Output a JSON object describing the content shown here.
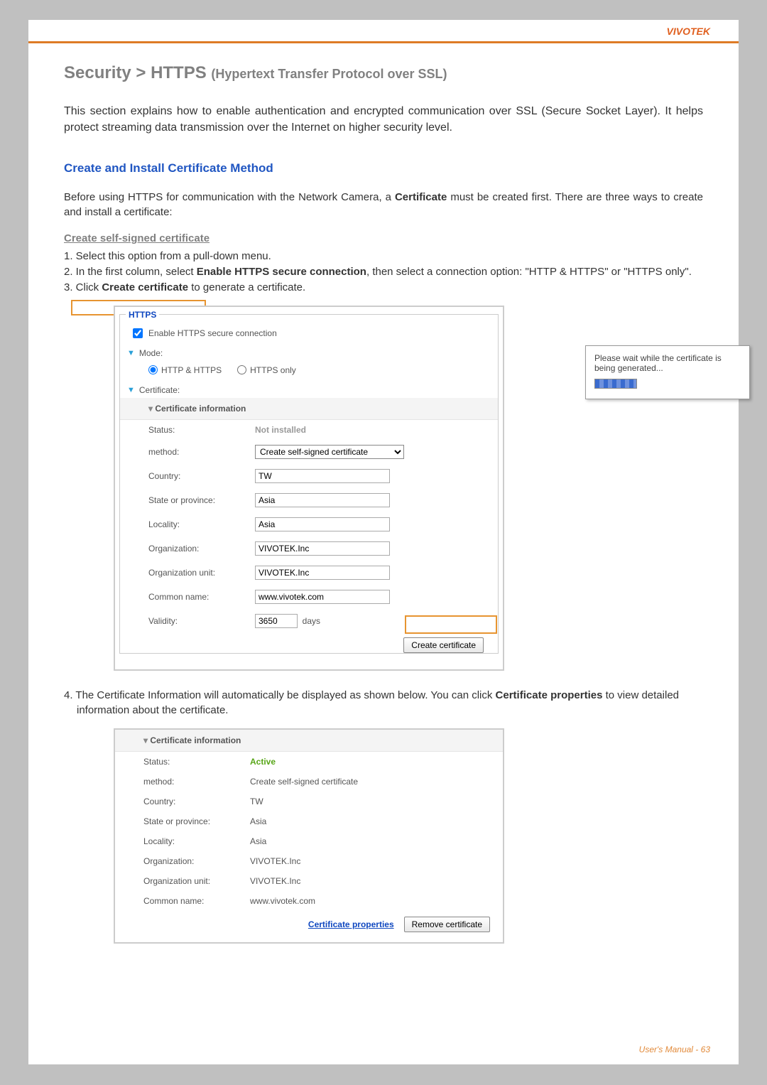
{
  "brand": "VIVOTEK",
  "heading_main": "Security  >   HTTPS ",
  "heading_sub": "(Hypertext Transfer Protocol over SSL)",
  "intro": "This section explains how to enable authentication and encrypted communication over SSL (Secure Socket Layer). It helps protect streaming data transmission over the Internet on higher security level.",
  "section1_title": "Create and Install Certificate Method",
  "section1_body_a": "Before using HTTPS for communication with the Network Camera, a ",
  "section1_body_b": "Certificate",
  "section1_body_c": " must be created first. There are three ways to create and install a certificate:",
  "subsec_title": "Create self-signed certificate",
  "step1": "1. Select this option from a pull-down menu.",
  "step2_a": "2. In the first column, select ",
  "step2_b": "Enable HTTPS secure connection",
  "step2_c": ", then select a connection option: \"HTTP & HTTPS\" or \"HTTPS only\".",
  "step3_a": "3. Click ",
  "step3_b": "Create certificate",
  "step3_c": " to generate a certificate.",
  "panel": {
    "legend": "HTTPS",
    "enable_label": "Enable HTTPS secure connection",
    "mode_label": "Mode:",
    "mode_opt1": "HTTP & HTTPS",
    "mode_opt2": "HTTPS only",
    "cert_label": "Certificate:",
    "cert_info_hdr": "Certificate information",
    "rows": {
      "status_lbl": "Status:",
      "status_val": "Not installed",
      "method_lbl": "method:",
      "method_val": "Create self-signed certificate",
      "country_lbl": "Country:",
      "country_val": "TW",
      "state_lbl": "State or province:",
      "state_val": "Asia",
      "locality_lbl": "Locality:",
      "locality_val": "Asia",
      "org_lbl": "Organization:",
      "org_val": "VIVOTEK.Inc",
      "orgunit_lbl": "Organization unit:",
      "orgunit_val": "VIVOTEK.Inc",
      "cn_lbl": "Common name:",
      "cn_val": "www.vivotek.com",
      "validity_lbl": "Validity:",
      "validity_val": "3650",
      "validity_unit": "days"
    },
    "create_btn": "Create certificate",
    "popup_text": "Please wait while the certificate is being generated..."
  },
  "step4_a": "4. The Certificate Information will automatically be displayed as shown below. You can click ",
  "step4_b": "Certificate properties",
  "step4_c": " to view detailed information about the certificate.",
  "panel2": {
    "cert_info_hdr": "Certificate information",
    "status_lbl": "Status:",
    "status_val": "Active",
    "method_lbl": "method:",
    "method_val": "Create self-signed certificate",
    "country_lbl": "Country:",
    "country_val": "TW",
    "state_lbl": "State or province:",
    "state_val": "Asia",
    "locality_lbl": "Locality:",
    "locality_val": "Asia",
    "org_lbl": "Organization:",
    "org_val": "VIVOTEK.Inc",
    "orgunit_lbl": "Organization unit:",
    "orgunit_val": "VIVOTEK.Inc",
    "cn_lbl": "Common name:",
    "cn_val": "www.vivotek.com",
    "proplink": "Certificate properties",
    "remove_btn": "Remove certificate"
  },
  "footer_label": "User's Manual - ",
  "footer_page": "63"
}
